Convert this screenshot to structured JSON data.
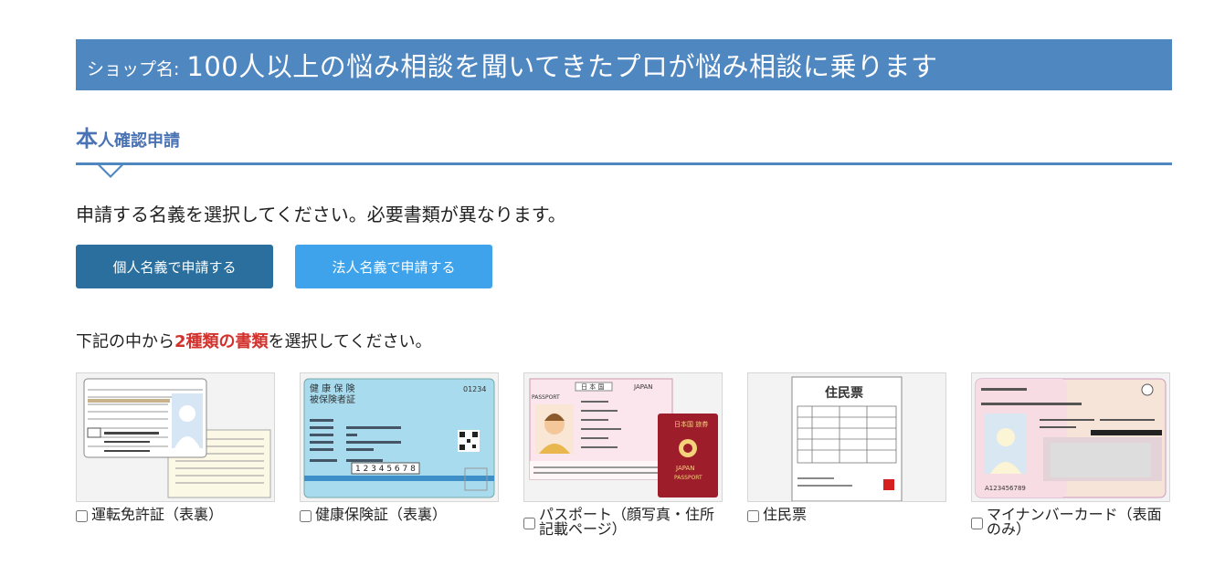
{
  "shop": {
    "prefix": "ショップ名:",
    "name": "100人以上の悩み相談を聞いてきたプロが悩み相談に乗ります"
  },
  "section": {
    "title_first": "本",
    "title_rest": "人確認申請"
  },
  "instruction": "申請する名義を選択してください。必要書類が異なります。",
  "buttons": {
    "personal": "個人名義で申請する",
    "corporate": "法人名義で申請する"
  },
  "document_instruction": {
    "before": "下記の中から",
    "highlight": "2種類の書類",
    "after": "を選択してください。"
  },
  "documents": [
    {
      "label": "運転免許証（表裏）",
      "icon": "drivers-license-icon",
      "checked": false
    },
    {
      "label": "健康保険証（表裏）",
      "icon": "health-insurance-card-icon",
      "checked": false
    },
    {
      "label": "パスポート（顔写真・住所記載ページ）",
      "icon": "passport-icon",
      "checked": false
    },
    {
      "label": "住民票",
      "icon": "resident-record-icon",
      "checked": false
    },
    {
      "label": "マイナンバーカード（表面のみ）",
      "icon": "my-number-card-icon",
      "checked": false
    }
  ],
  "card_text": {
    "health_header": "健 康 保 険",
    "health_sub": "被保険者証",
    "health_number": "01234",
    "health_id": "1 2 3 4 5 6 7 8",
    "passport_country": "日 本 国",
    "passport_japan": "JAPAN",
    "passport_word": "PASSPORT",
    "passport_book_title": "日本国 旅券",
    "resident_title": "住民票",
    "mynumber_id": "A123456789"
  },
  "colors": {
    "header_bg": "#4f87c0",
    "btn_personal": "#2a6f9e",
    "btn_corporate": "#3fa3ec",
    "highlight": "#d2312c"
  }
}
